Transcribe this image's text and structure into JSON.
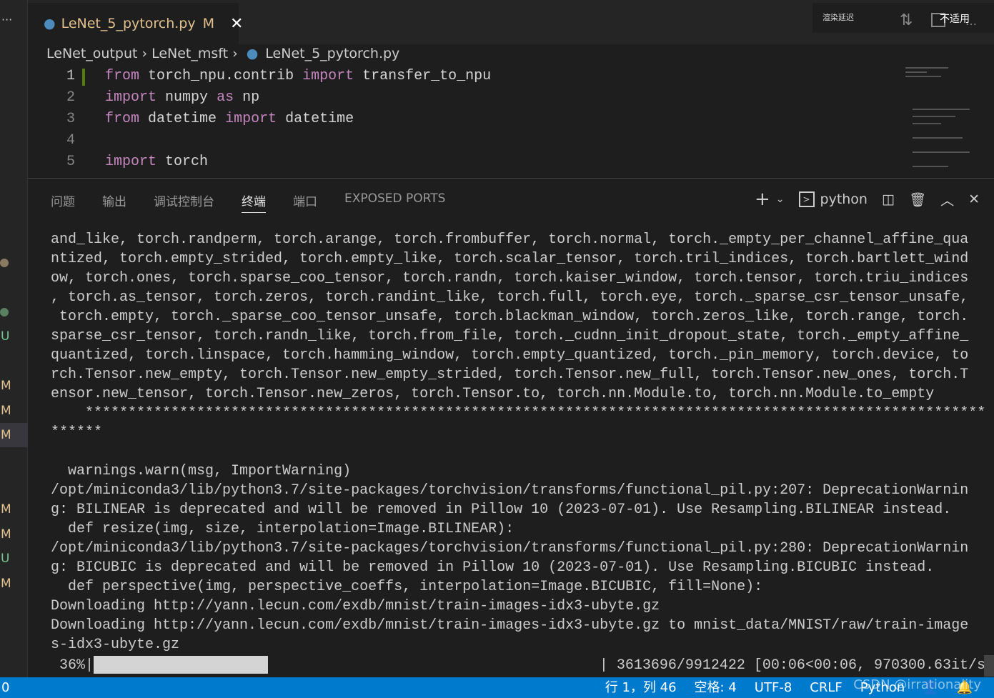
{
  "tab": {
    "filename": "LeNet_5_pytorch.py",
    "badge": "M"
  },
  "titlebar": {
    "render_delay": "渲染延迟",
    "na": "不适用"
  },
  "breadcrumb": [
    "LeNet_output",
    "LeNet_msft",
    "LeNet_5_pytorch.py"
  ],
  "sidebar": {
    "badges": [
      "U",
      "M",
      "M",
      "M",
      "M",
      "M",
      "U",
      "M"
    ]
  },
  "editor": {
    "lines": [
      {
        "n": "1",
        "parts": [
          [
            "kw",
            "from"
          ],
          [
            "",
            "torch_npu.contrib"
          ],
          [
            "kw",
            "import"
          ],
          [
            "",
            "transfer_to_npu"
          ]
        ]
      },
      {
        "n": "2",
        "parts": [
          [
            "kw",
            "import"
          ],
          [
            "",
            "numpy"
          ],
          [
            "kw",
            "as"
          ],
          [
            "",
            "np"
          ]
        ]
      },
      {
        "n": "3",
        "parts": [
          [
            "kw",
            "from"
          ],
          [
            "",
            "datetime"
          ],
          [
            "kw",
            "import"
          ],
          [
            "",
            "datetime"
          ]
        ]
      },
      {
        "n": "4",
        "parts": []
      },
      {
        "n": "5",
        "parts": [
          [
            "kw",
            "import"
          ],
          [
            "",
            "torch"
          ]
        ]
      }
    ]
  },
  "panel": {
    "tabs": [
      "问题",
      "输出",
      "调试控制台",
      "终端",
      "端口",
      "EXPOSED PORTS"
    ],
    "active_tab": "终端",
    "shell": "python"
  },
  "terminal": {
    "lines": [
      "and_like, torch.randperm, torch.arange, torch.frombuffer, torch.normal, torch._empty_per_channel_affine_qua",
      "ntized, torch.empty_strided, torch.empty_like, torch.scalar_tensor, torch.tril_indices, torch.bartlett_wind",
      "ow, torch.ones, torch.sparse_coo_tensor, torch.randn, torch.kaiser_window, torch.tensor, torch.triu_indices",
      ", torch.as_tensor, torch.zeros, torch.randint_like, torch.full, torch.eye, torch._sparse_csr_tensor_unsafe,",
      " torch.empty, torch._sparse_coo_tensor_unsafe, torch.blackman_window, torch.zeros_like, torch.range, torch.",
      "sparse_csr_tensor, torch.randn_like, torch.from_file, torch._cudnn_init_dropout_state, torch._empty_affine_",
      "quantized, torch.linspace, torch.hamming_window, torch.empty_quantized, torch._pin_memory, torch.device, to",
      "rch.Tensor.new_empty, torch.Tensor.new_empty_strided, torch.Tensor.new_full, torch.Tensor.new_ones, torch.T",
      "ensor.new_tensor, torch.Tensor.new_zeros, torch.Tensor.to, torch.nn.Module.to, torch.nn.Module.to_empty",
      "    *********************************************************************************************************",
      "******",
      "",
      "  warnings.warn(msg, ImportWarning)",
      "/opt/miniconda3/lib/python3.7/site-packages/torchvision/transforms/functional_pil.py:207: DeprecationWarnin",
      "g: BILINEAR is deprecated and will be removed in Pillow 10 (2023-07-01). Use Resampling.BILINEAR instead.",
      "  def resize(img, size, interpolation=Image.BILINEAR):",
      "/opt/miniconda3/lib/python3.7/site-packages/torchvision/transforms/functional_pil.py:280: DeprecationWarnin",
      "g: BICUBIC is deprecated and will be removed in Pillow 10 (2023-07-01). Use Resampling.BICUBIC instead.",
      "  def perspective(img, perspective_coeffs, interpolation=Image.BICUBIC, fill=None):",
      "Downloading http://yann.lecun.com/exdb/mnist/train-images-idx3-ubyte.gz",
      "Downloading http://yann.lecun.com/exdb/mnist/train-images-idx3-ubyte.gz to mnist_data/MNIST/raw/train-image",
      "s-idx3-ubyte.gz"
    ],
    "progress": {
      "percent_label": " 36%|",
      "percent": 36,
      "stats": "| 3613696/9912422 [00:06<00:06, 970300.63it/s",
      "cursor_char": "]"
    }
  },
  "status": {
    "left": "0",
    "items": [
      "行 1，列 46",
      "空格: 4",
      "UTF-8",
      "CRLF",
      "Python"
    ],
    "watermark": "CSDN @irrationality"
  },
  "colors": {
    "status_bar": "#007acc",
    "keyword": "#c586c0",
    "modified": "#e2c08d"
  }
}
